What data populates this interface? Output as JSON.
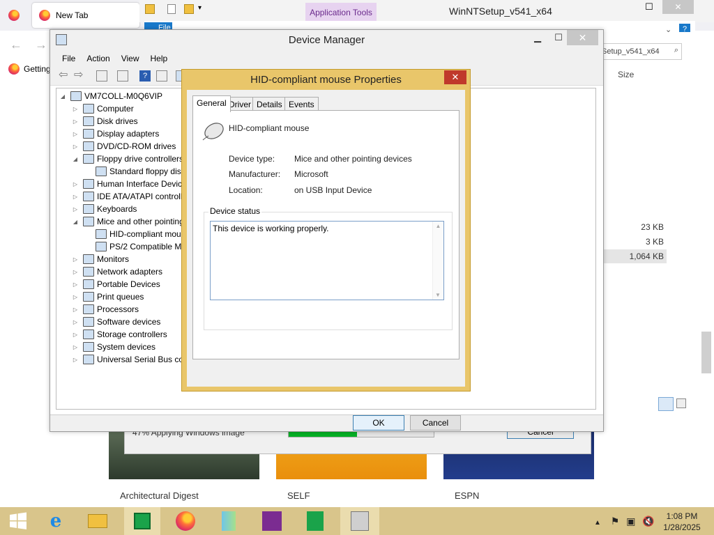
{
  "firefox": {
    "tab_title": "New Tab",
    "bookmark": "Getting",
    "cards": [
      {
        "label": "Architectural Digest"
      },
      {
        "label": "SELF"
      },
      {
        "label": "ESPN"
      }
    ]
  },
  "explorer": {
    "ribbon_context": "Application Tools",
    "title": "WinNTSetup_v541_x64",
    "file_tab": "File",
    "search_text": "Setup_v541_x64",
    "size_header": "Size",
    "sizes": [
      "23 KB",
      "3 KB",
      "1,064 KB"
    ]
  },
  "setup": {
    "progress_text": "47% Applying Windows image",
    "progress": 0.47,
    "cancel": "Cancel"
  },
  "device_manager": {
    "title": "Device Manager",
    "menu": [
      "File",
      "Action",
      "View",
      "Help"
    ],
    "root": "VM7COLL-M0Q6VIP",
    "tree": [
      {
        "label": "Computer",
        "level": 1,
        "expander": "collapsed"
      },
      {
        "label": "Disk drives",
        "level": 1,
        "expander": "collapsed"
      },
      {
        "label": "Display adapters",
        "level": 1,
        "expander": "collapsed"
      },
      {
        "label": "DVD/CD-ROM drives",
        "level": 1,
        "expander": "collapsed"
      },
      {
        "label": "Floppy drive controllers",
        "level": 1,
        "expander": "expanded"
      },
      {
        "label": "Standard floppy disk controller",
        "level": 2,
        "expander": "none"
      },
      {
        "label": "Human Interface Devices",
        "level": 1,
        "expander": "collapsed"
      },
      {
        "label": "IDE ATA/ATAPI controllers",
        "level": 1,
        "expander": "collapsed"
      },
      {
        "label": "Keyboards",
        "level": 1,
        "expander": "collapsed"
      },
      {
        "label": "Mice and other pointing devices",
        "level": 1,
        "expander": "expanded"
      },
      {
        "label": "HID-compliant mouse",
        "level": 2,
        "expander": "none"
      },
      {
        "label": "PS/2 Compatible Mouse",
        "level": 2,
        "expander": "none"
      },
      {
        "label": "Monitors",
        "level": 1,
        "expander": "collapsed"
      },
      {
        "label": "Network adapters",
        "level": 1,
        "expander": "collapsed"
      },
      {
        "label": "Portable Devices",
        "level": 1,
        "expander": "collapsed"
      },
      {
        "label": "Print queues",
        "level": 1,
        "expander": "collapsed"
      },
      {
        "label": "Processors",
        "level": 1,
        "expander": "collapsed"
      },
      {
        "label": "Software devices",
        "level": 1,
        "expander": "collapsed"
      },
      {
        "label": "Storage controllers",
        "level": 1,
        "expander": "collapsed"
      },
      {
        "label": "System devices",
        "level": 1,
        "expander": "collapsed"
      },
      {
        "label": "Universal Serial Bus controllers",
        "level": 1,
        "expander": "collapsed"
      }
    ]
  },
  "properties": {
    "title": "HID-compliant mouse Properties",
    "tabs": [
      "General",
      "Driver",
      "Details",
      "Events"
    ],
    "active_tab": "General",
    "device_name": "HID-compliant mouse",
    "fields": [
      {
        "label": "Device type:",
        "value": "Mice and other pointing devices"
      },
      {
        "label": "Manufacturer:",
        "value": "Microsoft"
      },
      {
        "label": "Location:",
        "value": "on USB Input Device"
      }
    ],
    "status_group": "Device status",
    "status_text": "This device is working properly.",
    "ok": "OK",
    "cancel": "Cancel"
  },
  "taskbar": {
    "time": "1:08 PM",
    "date": "1/28/2025"
  },
  "colors": {
    "dialog_border": "#e9c66a",
    "taskbar": "#d9c58b",
    "close_red": "#c0392b",
    "progress_green": "#06b025"
  }
}
